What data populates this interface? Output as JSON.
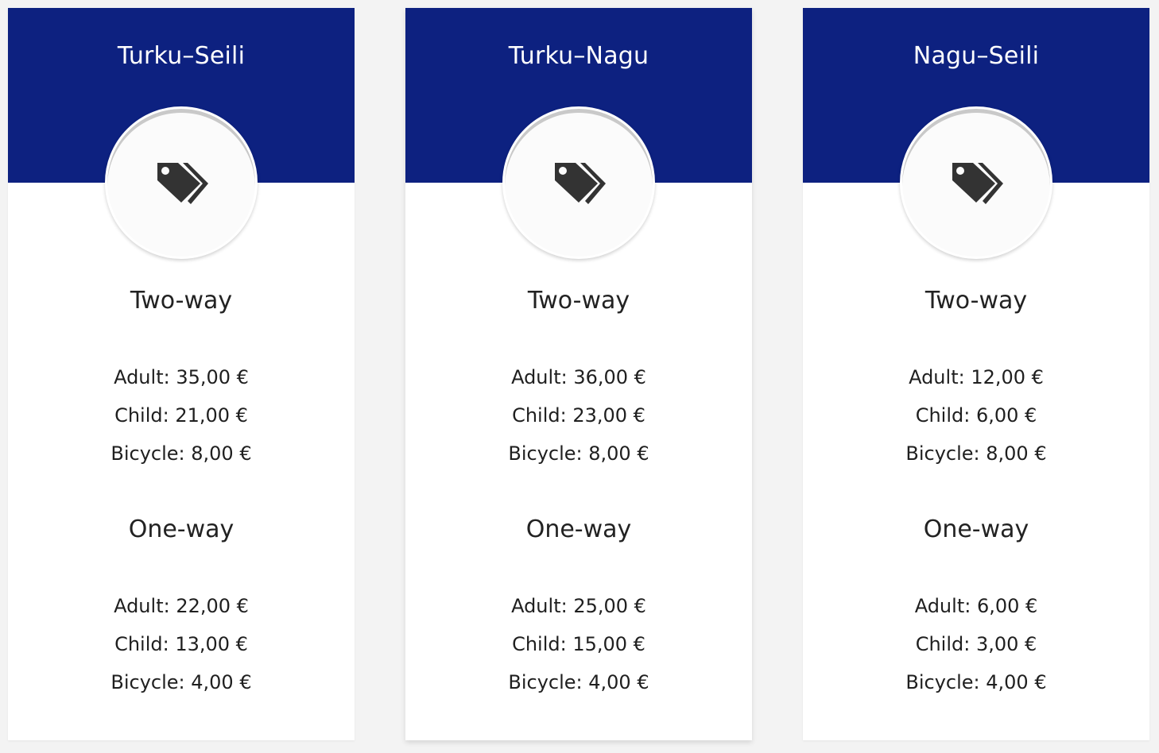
{
  "cards": [
    {
      "title": "Turku–Seili",
      "icon": "tags-icon",
      "two_way": {
        "label": "Two-way",
        "adult": "Adult: 35,00 €",
        "child": "Child: 21,00 €",
        "bicycle": "Bicycle: 8,00 €"
      },
      "one_way": {
        "label": "One-way",
        "adult": "Adult: 22,00 €",
        "child": "Child: 13,00 €",
        "bicycle": "Bicycle: 4,00 €"
      }
    },
    {
      "title": "Turku–Nagu",
      "icon": "tags-icon",
      "two_way": {
        "label": "Two-way",
        "adult": "Adult: 36,00 €",
        "child": "Child: 23,00 €",
        "bicycle": "Bicycle: 8,00 €"
      },
      "one_way": {
        "label": "One-way",
        "adult": "Adult: 25,00 €",
        "child": "Child: 15,00 €",
        "bicycle": "Bicycle: 4,00 €"
      }
    },
    {
      "title": "Nagu–Seili",
      "icon": "tags-icon",
      "two_way": {
        "label": "Two-way",
        "adult": "Adult: 12,00 €",
        "child": "Child: 6,00 €",
        "bicycle": "Bicycle: 8,00 €"
      },
      "one_way": {
        "label": "One-way",
        "adult": "Adult: 6,00 €",
        "child": "Child: 3,00 €",
        "bicycle": "Bicycle: 4,00 €"
      }
    }
  ],
  "colors": {
    "header": "#0d2180",
    "page_background": "#f3f3f3",
    "card_background": "#ffffff",
    "icon": "#333333"
  }
}
